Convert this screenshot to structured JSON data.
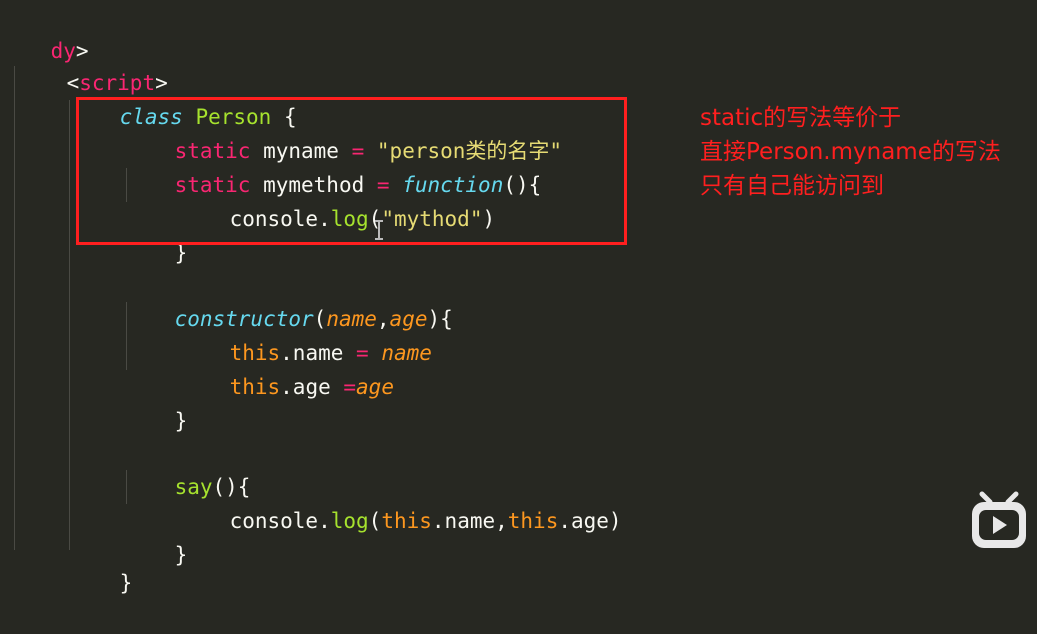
{
  "code": {
    "l1": [
      "dy",
      ">"
    ],
    "l2": [
      "<",
      "script",
      ">"
    ],
    "l3": [
      "class",
      " ",
      "Person",
      " {"
    ],
    "l4": [
      "static",
      " myname ",
      "=",
      " ",
      "\"person类的名字\""
    ],
    "l5": [
      "static",
      " mymethod ",
      "=",
      " ",
      "function",
      "(){"
    ],
    "l6": [
      "console.",
      "log",
      "(",
      "\"mythod\"",
      ")"
    ],
    "l7": [
      "}"
    ],
    "l8": [
      "constructor",
      "(",
      "name",
      ",",
      "age",
      "){"
    ],
    "l9": [
      "this",
      ".name ",
      "=",
      " ",
      "name"
    ],
    "l10": [
      "this",
      ".age ",
      "=",
      "age"
    ],
    "l11": [
      "}"
    ],
    "l12": [
      "say",
      "(){"
    ],
    "l13": [
      "console.",
      "log",
      "(",
      "this",
      ".name,",
      "this",
      ".age)"
    ],
    "l14": [
      "}"
    ],
    "l15": [
      "}"
    ]
  },
  "annotation": {
    "line1": "static的写法等价于",
    "line2": "直接Person.myname的写法",
    "line3": "只有自己能访问到"
  },
  "colors": {
    "background": "#272822",
    "annotation": "#ff1f1f"
  },
  "icons": {
    "cursor": "text-cursor-icon",
    "logo": "bilibili-logo-icon"
  }
}
